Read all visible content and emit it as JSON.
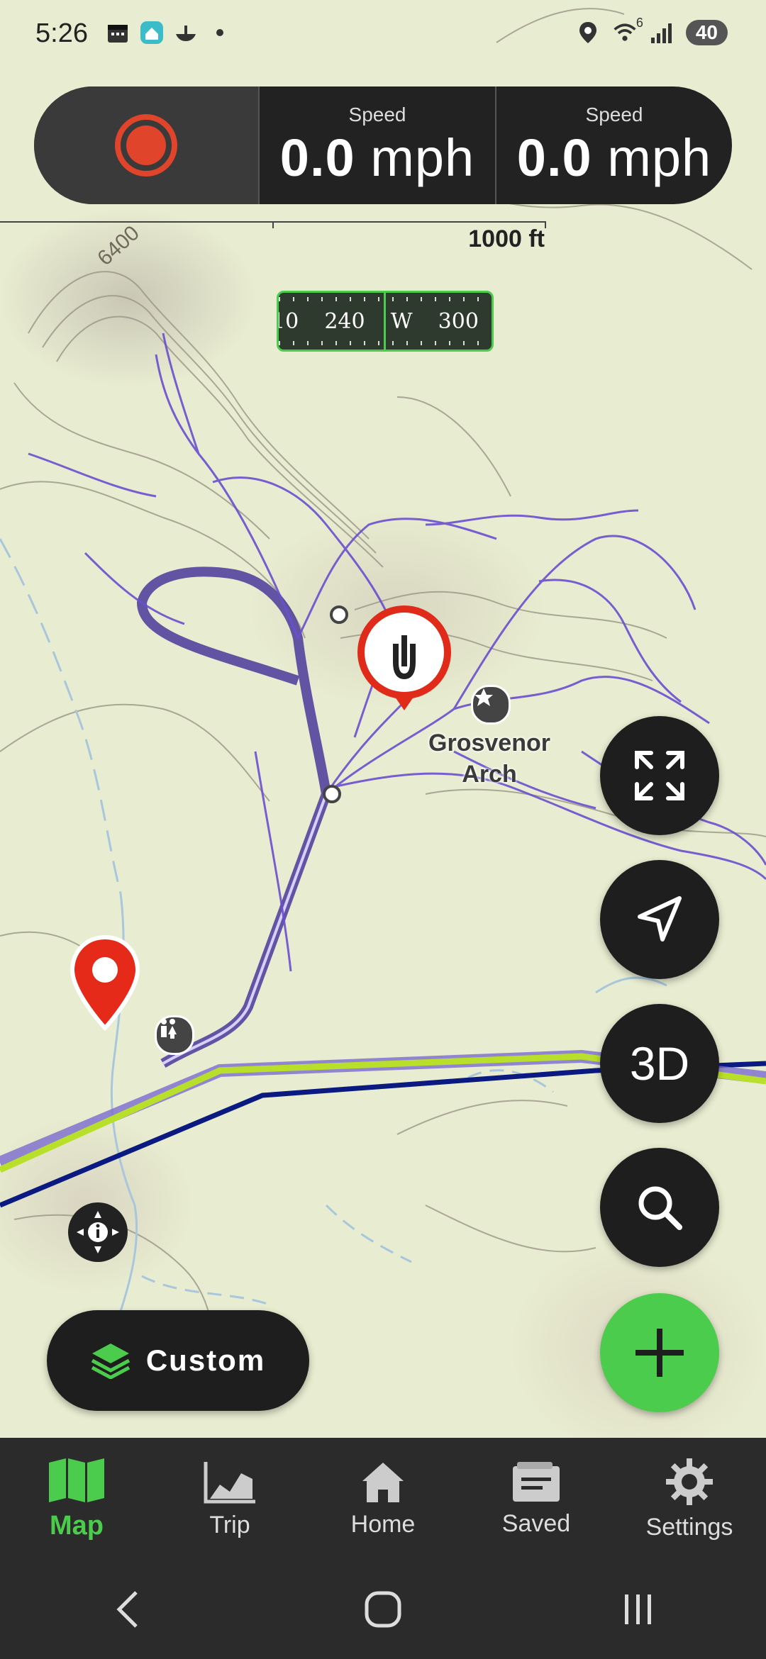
{
  "status_bar": {
    "time": "5:26",
    "network_label": "6",
    "battery": "40"
  },
  "speed_panel": {
    "left": {
      "label": "Speed",
      "value": "0.0",
      "unit": "mph"
    },
    "right": {
      "label": "Speed",
      "value": "0.0",
      "unit": "mph"
    }
  },
  "scale_bar": {
    "label": "1000 ft"
  },
  "compass": {
    "labels": [
      "10",
      "240",
      "W",
      "300"
    ]
  },
  "map": {
    "contour_label": "6400",
    "poi_name": "Grosvenor Arch"
  },
  "buttons": {
    "three_d": "3D",
    "layer": "Custom"
  },
  "bottom_nav": {
    "items": [
      {
        "label": "Map",
        "icon": "map-icon",
        "active": true
      },
      {
        "label": "Trip",
        "icon": "chart-icon",
        "active": false
      },
      {
        "label": "Home",
        "icon": "home-icon",
        "active": false
      },
      {
        "label": "Saved",
        "icon": "folder-icon",
        "active": false
      },
      {
        "label": "Settings",
        "icon": "gear-icon",
        "active": false
      }
    ]
  },
  "colors": {
    "accent": "#4ccc4c",
    "record": "#e0442a",
    "track": "#6a4fd0",
    "road_highlight": "#b8e02a",
    "road_blue": "#0a1a80"
  }
}
